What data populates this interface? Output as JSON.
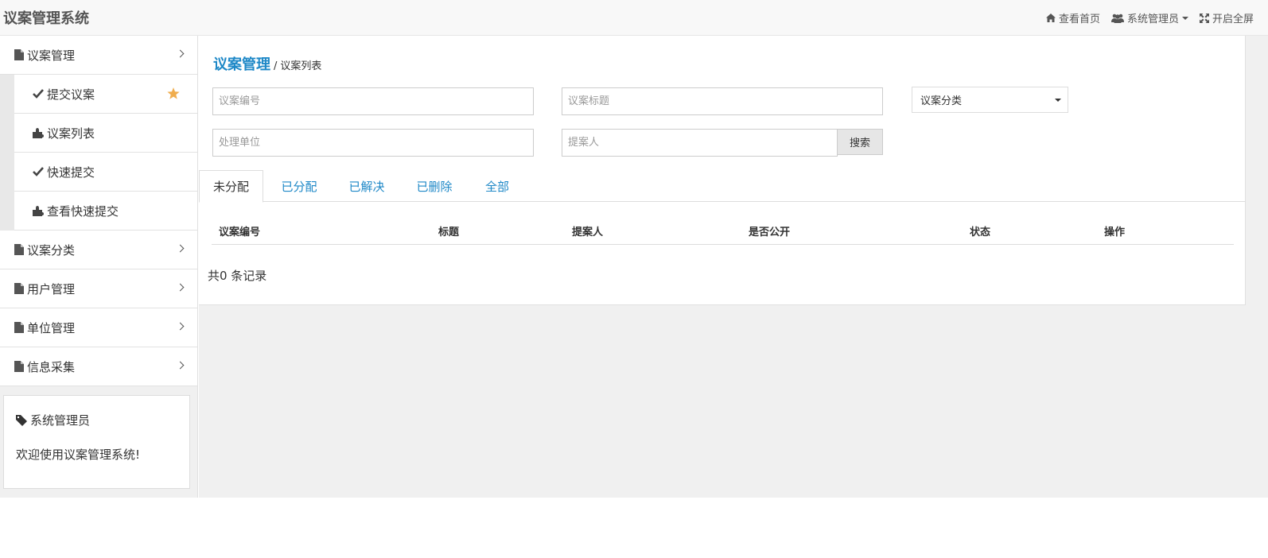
{
  "app": {
    "title": "议案管理系统"
  },
  "topnav": {
    "home": "查看首页",
    "user": "系统管理员",
    "fullscreen": "开启全屏"
  },
  "sidebar": {
    "items": [
      {
        "label": "议案管理",
        "expanded": true,
        "children": [
          {
            "label": "提交议案",
            "icon": "check-icon",
            "starred": true
          },
          {
            "label": "议案列表",
            "icon": "puzzle-icon"
          },
          {
            "label": "快速提交",
            "icon": "check-icon"
          },
          {
            "label": "查看快速提交",
            "icon": "puzzle-icon"
          }
        ]
      },
      {
        "label": "议案分类"
      },
      {
        "label": "用户管理"
      },
      {
        "label": "单位管理"
      },
      {
        "label": "信息采集"
      }
    ],
    "info_panel": {
      "title": "系统管理员",
      "text": "欢迎使用议案管理系统!"
    }
  },
  "breadcrumb": {
    "section": "议案管理",
    "separator": "/",
    "page": "议案列表"
  },
  "filters": {
    "number_placeholder": "议案编号",
    "title_placeholder": "议案标题",
    "category_selected": "议案分类",
    "unit_placeholder": "处理单位",
    "proposer_placeholder": "提案人",
    "search_label": "搜索"
  },
  "tabs": [
    "未分配",
    "已分配",
    "已解决",
    "已删除",
    "全部"
  ],
  "active_tab": 0,
  "table": {
    "headers": [
      "议案编号",
      "标题",
      "提案人",
      "是否公开",
      "状态",
      "操作"
    ],
    "rows": []
  },
  "total_text": "共0 条记录",
  "colors": {
    "accent": "#1e88c7",
    "star": "#f0ad4e"
  }
}
